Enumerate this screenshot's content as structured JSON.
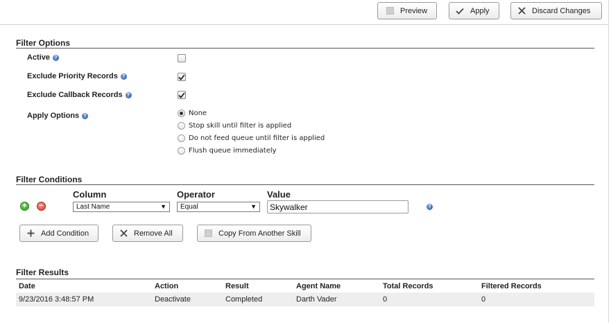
{
  "toolbar": {
    "preview_label": "Preview",
    "apply_label": "Apply",
    "discard_label": "Discard Changes"
  },
  "filter_options": {
    "title": "Filter Options",
    "active_label": "Active",
    "active_checked": false,
    "exclude_priority_label": "Exclude Priority Records",
    "exclude_priority_checked": true,
    "exclude_callback_label": "Exclude Callback Records",
    "exclude_callback_checked": true,
    "apply_options_label": "Apply Options",
    "apply_options": [
      {
        "label": "None",
        "selected": true
      },
      {
        "label": "Stop skill until filter is applied",
        "selected": false
      },
      {
        "label": "Do not feed queue until filter is applied",
        "selected": false
      },
      {
        "label": "Flush queue immediately",
        "selected": false
      }
    ]
  },
  "filter_conditions": {
    "title": "Filter Conditions",
    "column_header": "Column",
    "operator_header": "Operator",
    "value_header": "Value",
    "condition": {
      "column": "Last Name",
      "operator": "Equal",
      "value": "Skywalker"
    },
    "add_condition_label": "Add Condition",
    "remove_all_label": "Remove All",
    "copy_label": "Copy From Another Skill"
  },
  "filter_results": {
    "title": "Filter Results",
    "columns": [
      "Date",
      "Action",
      "Result",
      "Agent Name",
      "Total Records",
      "Filtered Records"
    ],
    "rows": [
      [
        "9/23/2016 3:48:57 PM",
        "Deactivate",
        "Completed",
        "Darth Vader",
        "0",
        "0"
      ]
    ]
  },
  "colors": {
    "help_icon": "#2f5fb3",
    "add_icon": "#2f9a1f",
    "remove_icon": "#d43c2a",
    "row_background": "#eeeeee"
  },
  "icons": {
    "preview": "square-icon",
    "apply": "checkmark-icon",
    "discard": "x-icon",
    "help": "help-icon",
    "add_row": "plus-circle-icon",
    "remove_row": "minus-circle-icon",
    "add_condition": "plus-icon",
    "remove_all": "x-icon",
    "copy": "square-icon"
  }
}
